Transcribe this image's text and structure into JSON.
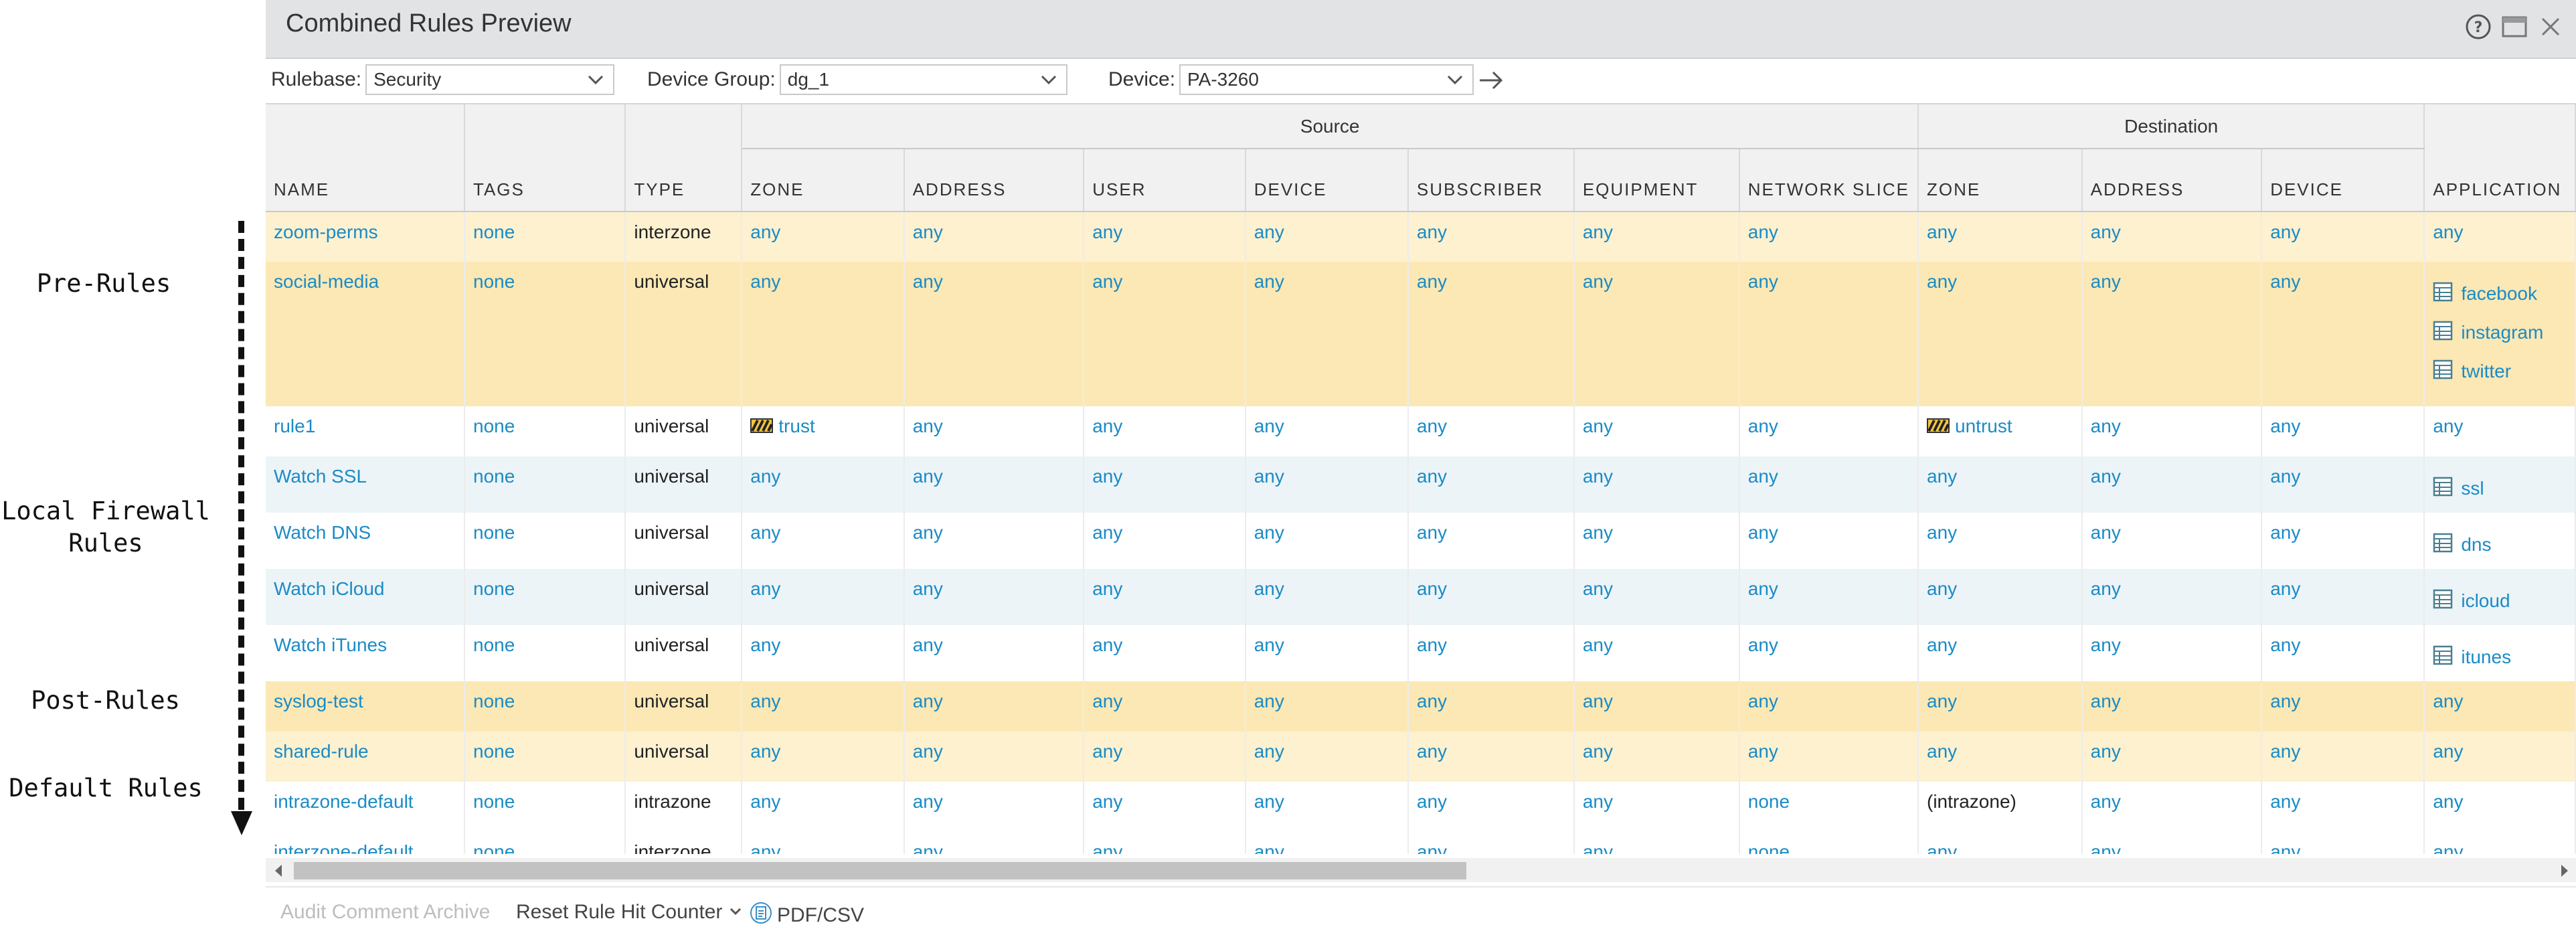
{
  "annotations": {
    "pre_rules": "Pre-Rules",
    "local_firewall_rules": "Local Firewall\nRules",
    "post_rules": "Post-Rules",
    "default_rules": "Default Rules"
  },
  "dialog": {
    "title": "Combined Rules Preview",
    "icons": [
      "help-icon",
      "maximize-icon",
      "close-icon"
    ]
  },
  "toolbar": {
    "rulebase_label": "Rulebase:",
    "rulebase_value": "Security",
    "device_group_label": "Device Group:",
    "device_group_value": "dg_1",
    "device_label": "Device:",
    "device_value": "PA-3260"
  },
  "table": {
    "groups": {
      "source": "Source",
      "destination": "Destination"
    },
    "columns": [
      "NAME",
      "TAGS",
      "TYPE",
      "ZONE",
      "ADDRESS",
      "USER",
      "DEVICE",
      "SUBSCRIBER",
      "EQUIPMENT",
      "NETWORK SLICE",
      "ZONE",
      "ADDRESS",
      "DEVICE",
      "APPLICATION"
    ],
    "rows": [
      {
        "section": "pre",
        "name": "zoom-perms",
        "tags": "none",
        "type": "interzone",
        "src_zone": "any",
        "src_address": "any",
        "user": "any",
        "src_device": "any",
        "subscriber": "any",
        "equipment": "any",
        "network_slice": "any",
        "dst_zone": "any",
        "dst_address": "any",
        "dst_device": "any",
        "applications": [
          "any"
        ]
      },
      {
        "section": "pre",
        "name": "social-media",
        "tags": "none",
        "type": "universal",
        "src_zone": "any",
        "src_address": "any",
        "user": "any",
        "src_device": "any",
        "subscriber": "any",
        "equipment": "any",
        "network_slice": "any",
        "dst_zone": "any",
        "dst_address": "any",
        "dst_device": "any",
        "applications": [
          "facebook",
          "instagram",
          "twitter"
        ]
      },
      {
        "section": "local",
        "name": "rule1",
        "tags": "none",
        "type": "universal",
        "src_zone": "trust",
        "src_address": "any",
        "user": "any",
        "src_device": "any",
        "subscriber": "any",
        "equipment": "any",
        "network_slice": "any",
        "dst_zone": "untrust",
        "dst_address": "any",
        "dst_device": "any",
        "applications": [
          "any"
        ]
      },
      {
        "section": "local",
        "name": "Watch SSL",
        "tags": "none",
        "type": "universal",
        "src_zone": "any",
        "src_address": "any",
        "user": "any",
        "src_device": "any",
        "subscriber": "any",
        "equipment": "any",
        "network_slice": "any",
        "dst_zone": "any",
        "dst_address": "any",
        "dst_device": "any",
        "applications": [
          "ssl"
        ]
      },
      {
        "section": "local",
        "name": "Watch DNS",
        "tags": "none",
        "type": "universal",
        "src_zone": "any",
        "src_address": "any",
        "user": "any",
        "src_device": "any",
        "subscriber": "any",
        "equipment": "any",
        "network_slice": "any",
        "dst_zone": "any",
        "dst_address": "any",
        "dst_device": "any",
        "applications": [
          "dns"
        ]
      },
      {
        "section": "local",
        "name": "Watch iCloud",
        "tags": "none",
        "type": "universal",
        "src_zone": "any",
        "src_address": "any",
        "user": "any",
        "src_device": "any",
        "subscriber": "any",
        "equipment": "any",
        "network_slice": "any",
        "dst_zone": "any",
        "dst_address": "any",
        "dst_device": "any",
        "applications": [
          "icloud"
        ]
      },
      {
        "section": "local",
        "name": "Watch iTunes",
        "tags": "none",
        "type": "universal",
        "src_zone": "any",
        "src_address": "any",
        "user": "any",
        "src_device": "any",
        "subscriber": "any",
        "equipment": "any",
        "network_slice": "any",
        "dst_zone": "any",
        "dst_address": "any",
        "dst_device": "any",
        "applications": [
          "itunes"
        ]
      },
      {
        "section": "post",
        "name": "syslog-test",
        "tags": "none",
        "type": "universal",
        "src_zone": "any",
        "src_address": "any",
        "user": "any",
        "src_device": "any",
        "subscriber": "any",
        "equipment": "any",
        "network_slice": "any",
        "dst_zone": "any",
        "dst_address": "any",
        "dst_device": "any",
        "applications": [
          "any"
        ]
      },
      {
        "section": "post",
        "name": "shared-rule",
        "tags": "none",
        "type": "universal",
        "src_zone": "any",
        "src_address": "any",
        "user": "any",
        "src_device": "any",
        "subscriber": "any",
        "equipment": "any",
        "network_slice": "any",
        "dst_zone": "any",
        "dst_address": "any",
        "dst_device": "any",
        "applications": [
          "any"
        ]
      },
      {
        "section": "default",
        "name": "intrazone-default",
        "tags": "none",
        "type": "intrazone",
        "src_zone": "any",
        "src_address": "any",
        "user": "any",
        "src_device": "any",
        "subscriber": "any",
        "equipment": "any",
        "network_slice": "none",
        "dst_zone": "(intrazone)",
        "dst_address": "any",
        "dst_device": "any",
        "applications": [
          "any"
        ]
      },
      {
        "section": "default",
        "name": "interzone-default",
        "tags": "none",
        "type": "interzone",
        "src_zone": "any",
        "src_address": "any",
        "user": "any",
        "src_device": "any",
        "subscriber": "any",
        "equipment": "any",
        "network_slice": "none",
        "dst_zone": "any",
        "dst_address": "any",
        "dst_device": "any",
        "applications": [
          "any"
        ]
      }
    ]
  },
  "footer": {
    "audit_comment_archive": "Audit Comment Archive",
    "reset_rule_hit_counter": "Reset Rule Hit Counter",
    "pdf_csv": "PDF/CSV"
  },
  "colors": {
    "link": "#1a8bc6",
    "pre_post_row": "#fce8b4",
    "pre_post_row_light": "#fdf1d0",
    "local_row_alt": "#edf4f7",
    "header_bg": "#f1f1f1",
    "titlebar_bg": "#e2e3e4"
  }
}
